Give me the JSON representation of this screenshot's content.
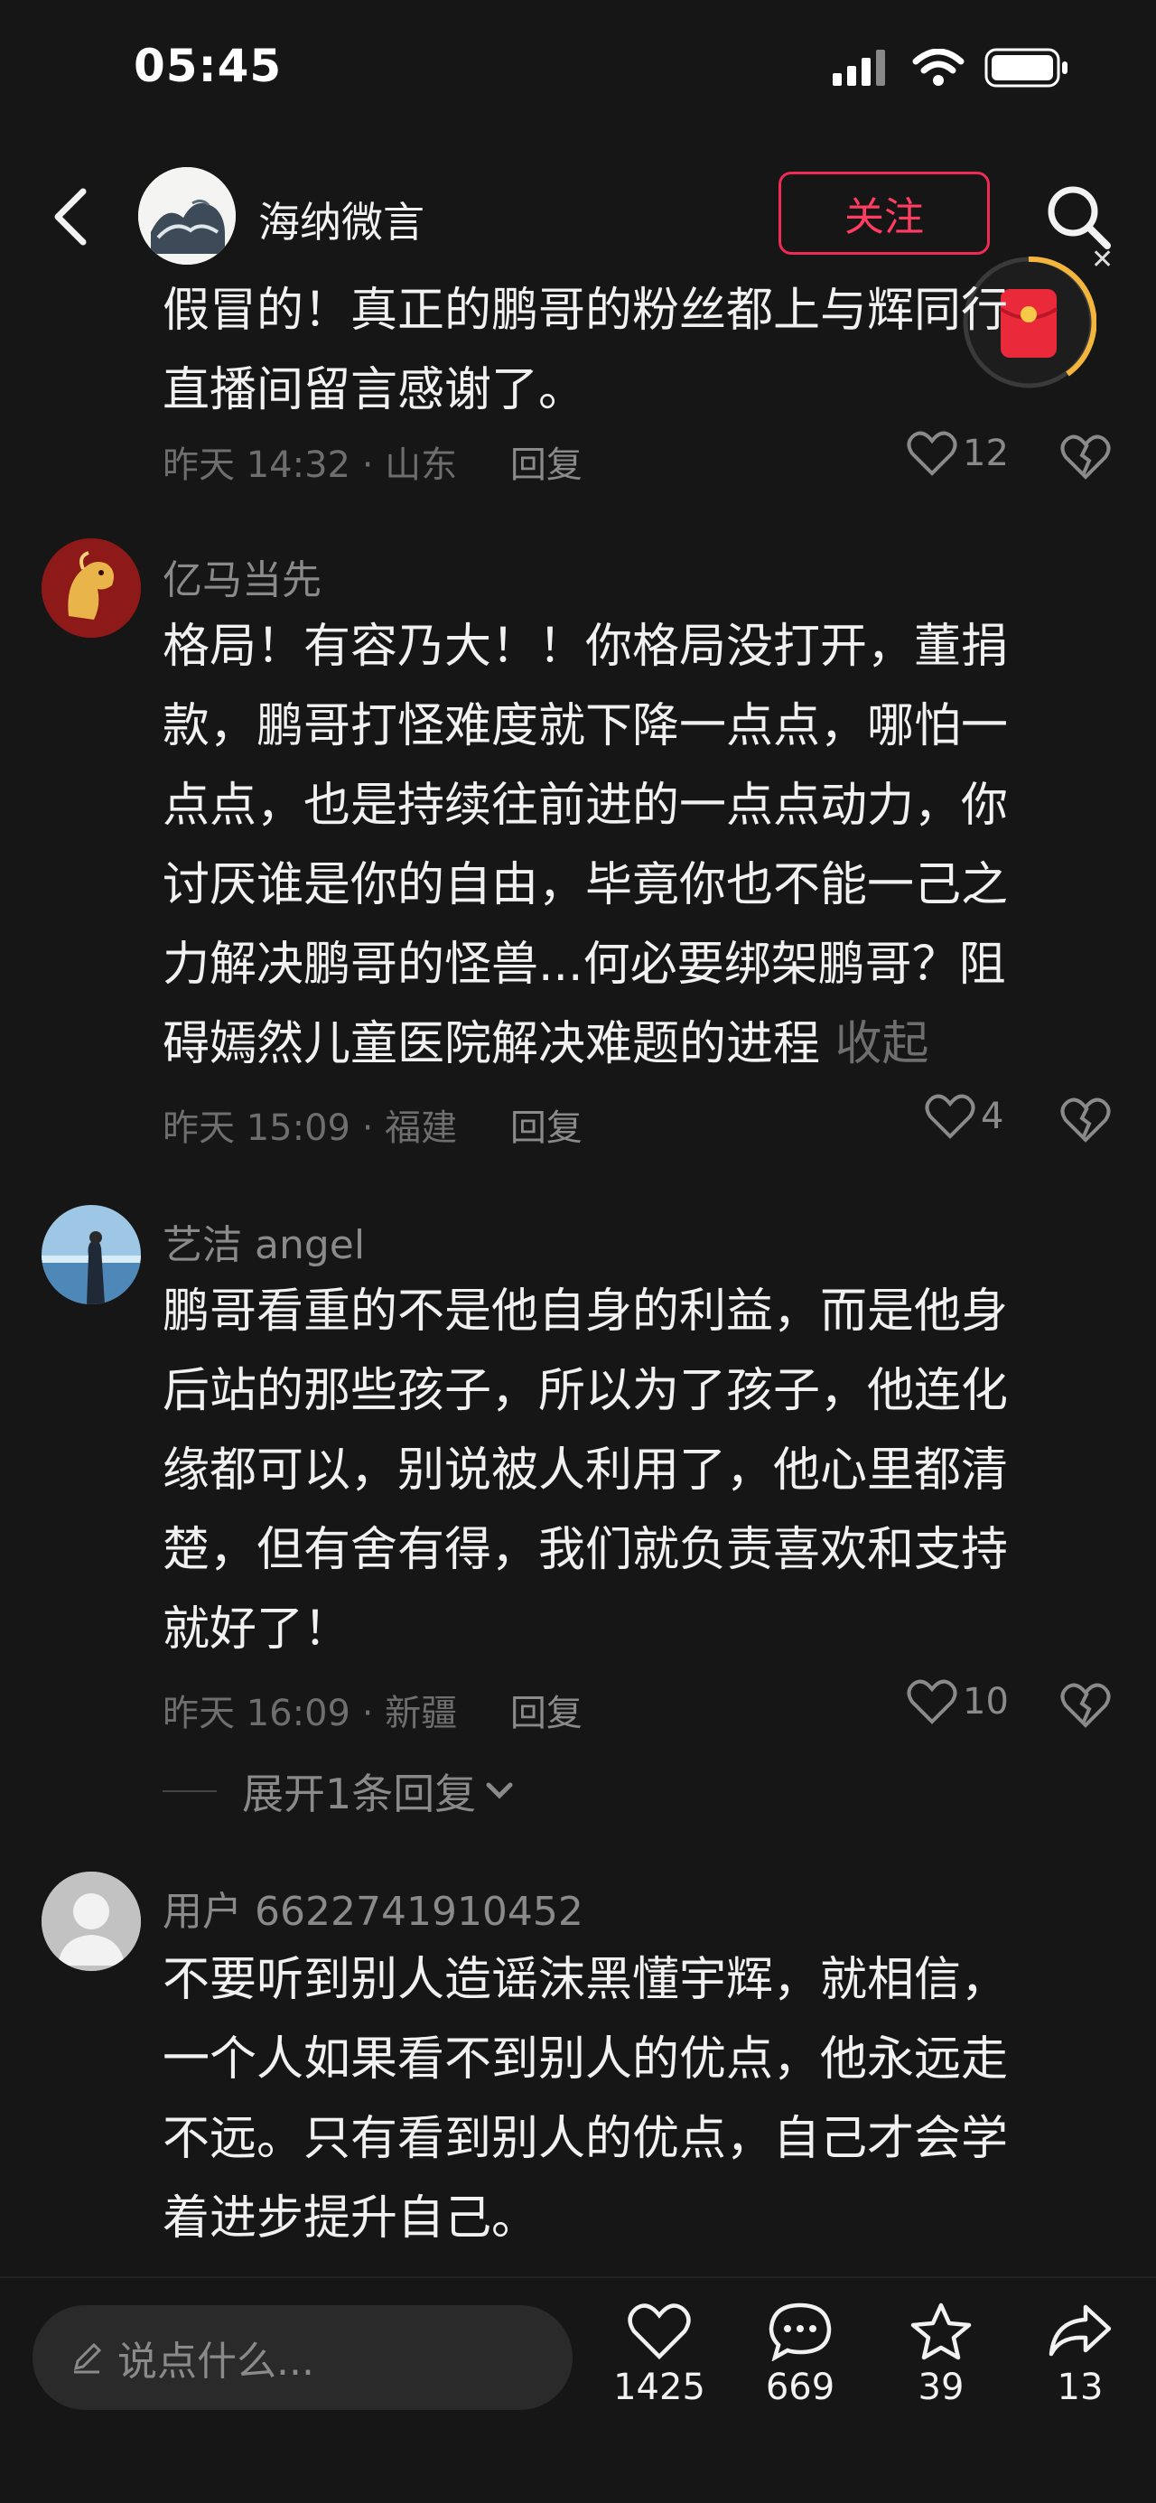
{
  "status": {
    "time": "05:45"
  },
  "header": {
    "channel_name": "海纳微言",
    "follow_label": "关注"
  },
  "comments": [
    {
      "text": "假冒的！真正的鹏哥的粉丝都上与辉同行直播间留言感谢了。",
      "line1": "假冒的！真正的鹏哥的粉丝都上与辉同行",
      "line2": "直播间留言感谢了。",
      "meta_time": "昨天 14:32 · 山东",
      "reply": "回复",
      "likes": "12"
    },
    {
      "user": "亿马当先",
      "lines": [
        "格局！有容乃大！！你格局没打开，董捐",
        "款，鹏哥打怪难度就下降一点点，哪怕一",
        "点点，也是持续往前进的一点点动力，你",
        "讨厌谁是你的自由，毕竟你也不能一己之",
        "力解决鹏哥的怪兽...何必要绑架鹏哥？阻",
        "碍嫣然儿童医院解决难题的进程"
      ],
      "collapse": "收起",
      "meta_time": "昨天 15:09 · 福建",
      "reply": "回复",
      "likes": "4"
    },
    {
      "user": "艺洁 angel",
      "lines": [
        "鹏哥看重的不是他自身的利益，而是他身",
        "后站的那些孩子，所以为了孩子，他连化",
        "缘都可以，别说被人利用了，他心里都清",
        "楚，但有舍有得，我们就负责喜欢和支持",
        "就好了！"
      ],
      "meta_time": "昨天 16:09 · 新疆",
      "reply": "回复",
      "likes": "10",
      "expand": "展开1条回复"
    },
    {
      "user": "用户 6622741910452",
      "lines": [
        "不要听到别人造谣沫黑懂宇辉，就相信，",
        "一个人如果看不到别人的优点，他永远走",
        "不远。只有看到别人的优点，自己才会学",
        "着进步提升自己。"
      ]
    }
  ],
  "bottom": {
    "placeholder": "说点什么...",
    "likes": "1425",
    "comments": "669",
    "favorites": "39",
    "shares": "13"
  },
  "colors": {
    "accent": "#ef2b55",
    "background": "#161616"
  },
  "icons": [
    "back-arrow-icon",
    "search-icon",
    "heart-icon",
    "broken-heart-icon",
    "comment-icon",
    "star-icon",
    "share-icon",
    "pen-icon",
    "chevron-down-icon",
    "red-packet-icon"
  ]
}
